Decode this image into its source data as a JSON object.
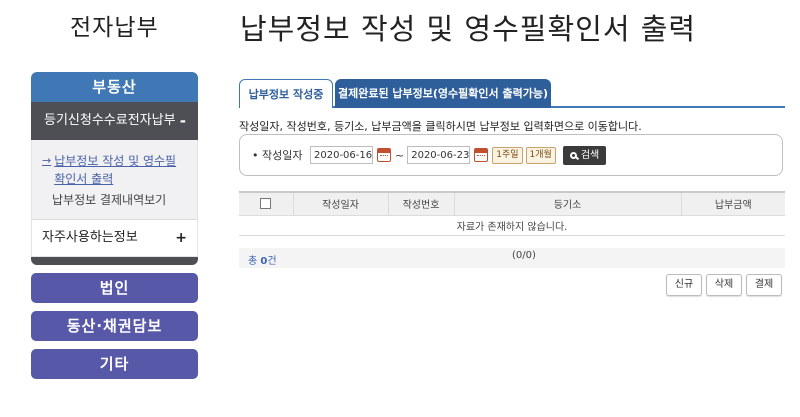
{
  "sidebar": {
    "title": "전자납부",
    "realty": "부동산",
    "sub_menu": {
      "label": "등기신청수수료전자납부",
      "toggle": "-",
      "items": [
        "납부정보 작성 및 영수필확인서 출력",
        "납부정보 결제내역보기"
      ]
    },
    "favorites": {
      "label": "자주사용하는정보",
      "toggle": "+"
    },
    "corp": "법인",
    "movable": "동산·채권담보",
    "other": "기타"
  },
  "page_title": "납부정보 작성 및 영수필확인서 출력",
  "tabs": [
    {
      "label": "납부정보 작성중",
      "active": true
    },
    {
      "label": "결제완료된 납부정보(영수필확인서 출력가능)",
      "active": false
    }
  ],
  "instruction": "작성일자, 작성번호, 등기소, 납부금액을 클릭하시면 납부정보 입력화면으로 이동합니다.",
  "search": {
    "label": "작성일자",
    "bullet": "•",
    "date_from": "2020-06-16",
    "separator": "~",
    "date_to": "2020-06-23",
    "week_btn": "1주일",
    "month_btn": "1개월",
    "search_btn": "검색"
  },
  "table": {
    "headers": [
      "작성일자",
      "작성번호",
      "등기소",
      "납부금액"
    ],
    "empty_message": "자료가 존재하지 않습니다."
  },
  "summary": {
    "total_prefix": "총",
    "total_count": "0",
    "total_suffix": "건",
    "paging": "(0/0)"
  },
  "actions": {
    "new": "신규",
    "delete": "삭제",
    "pay": "결제"
  },
  "colors": {
    "primary": "#3f78b5",
    "tab_inactive": "#2f5f9a",
    "sidebar_dark": "#4d4f55",
    "category": "#5858a8"
  }
}
